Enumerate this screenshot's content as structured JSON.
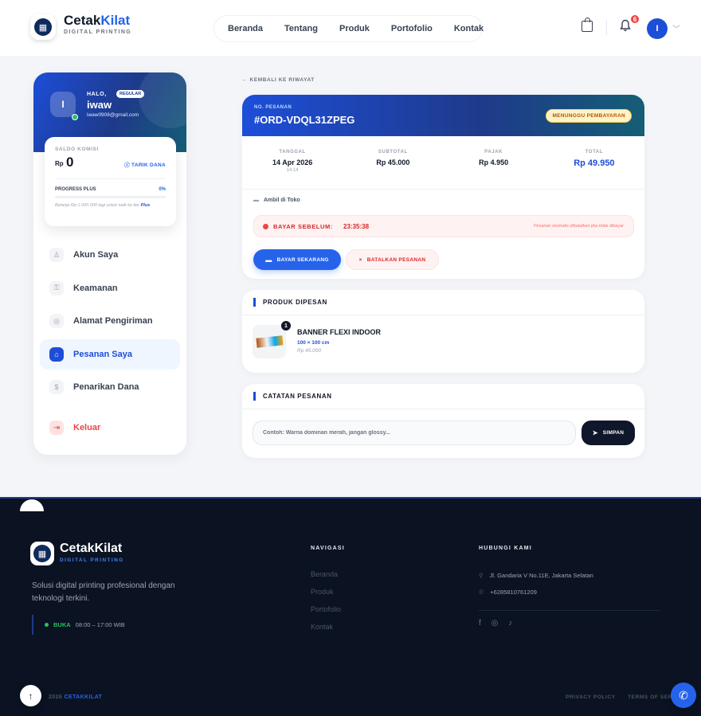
{
  "header": {
    "brand_main": "Cetak",
    "brand_accent": "Kilat",
    "brand_sub": "DIGITAL PRINTING",
    "nav": [
      "Beranda",
      "Tentang",
      "Produk",
      "Portofolio",
      "Kontak"
    ],
    "notif_count": "6",
    "avatar_initial": "I"
  },
  "sidebar": {
    "greeting": "HALO,",
    "tier": "REGULAR",
    "avatar_initial": "I",
    "name": "iwaw",
    "email": "iwaw0908@gmail.com",
    "saldo_label": "SALDO KOMISI",
    "currency": "Rp",
    "saldo_amount": "0",
    "withdraw_label": "TARIK DANA",
    "progress_label": "PROGRESS PLUS",
    "progress_pct": "0%",
    "progress_value": 0,
    "hint_text": "Belanja Rp 1.000.000 lagi untuk naik ke tier",
    "hint_tier": "Plus",
    "menu": [
      {
        "label": "Akun Saya",
        "icon": "user-icon"
      },
      {
        "label": "Keamanan",
        "icon": "key-icon"
      },
      {
        "label": "Alamat Pengiriman",
        "icon": "location-icon"
      },
      {
        "label": "Pesanan Saya",
        "icon": "bag-icon",
        "active": true
      },
      {
        "label": "Penarikan Dana",
        "icon": "coin-icon"
      }
    ],
    "logout_label": "Keluar"
  },
  "order": {
    "back_label": "← KEMBALI KE RIWAYAT",
    "no_label": "NO. PESANAN",
    "number": "#ORD-VDQL31ZPEG",
    "status": "MENUNGGU PEMBAYARAN",
    "stats": {
      "date_label": "TANGGAL",
      "date_value": "14 Apr 2026",
      "date_time": "14:14",
      "subtotal_label": "SUBTOTAL",
      "subtotal_value": "Rp 45.000",
      "tax_label": "PAJAK",
      "tax_value": "Rp 4.950",
      "total_label": "TOTAL",
      "total_value": "Rp 49.950"
    },
    "pickup": "Ambil di Toko",
    "deadline_label": "BAYAR SEBELUM:",
    "deadline_time": "23:35:38",
    "deadline_note": "Pesanan otomatis dibatalkan jika tidak dibayar",
    "pay_button": "BAYAR SEKARANG",
    "cancel_button": "BATALKAN PESANAN"
  },
  "products": {
    "title": "PRODUK DIPESAN",
    "items": [
      {
        "qty": "1",
        "name": "BANNER FLEXI INDOOR",
        "size": "100 × 100 cm",
        "price": "Rp 45.000"
      }
    ]
  },
  "notes": {
    "title": "CATATAN PESANAN",
    "placeholder": "Contoh: Warna dominan merah, jangan glossy...",
    "save_button": "SIMPAN"
  },
  "footer": {
    "brand": "CetakKilat",
    "brand_sub": "DIGITAL PRINTING",
    "description": "Solusi digital printing profesional dengan teknologi terkini.",
    "open_label": "BUKA",
    "hours": "08:00 – 17:00 WIB",
    "nav_title": "NAVIGASI",
    "nav": [
      "Beranda",
      "Produk",
      "Portofolio",
      "Kontak"
    ],
    "contact_title": "HUBUNGI KAMI",
    "address": "Jl. Gandaria V No.11E, Jakarta Selatan",
    "phone": "+6285810761209",
    "copyright_year": "2026",
    "copyright_brand": "CETAKKILAT",
    "privacy": "PRIVACY POLICY",
    "terms": "TERMS OF SER"
  },
  "colors": {
    "primary": "#2563eb",
    "dark": "#0b1222",
    "danger": "#ef4444",
    "warning_bg": "#fef3c7"
  }
}
